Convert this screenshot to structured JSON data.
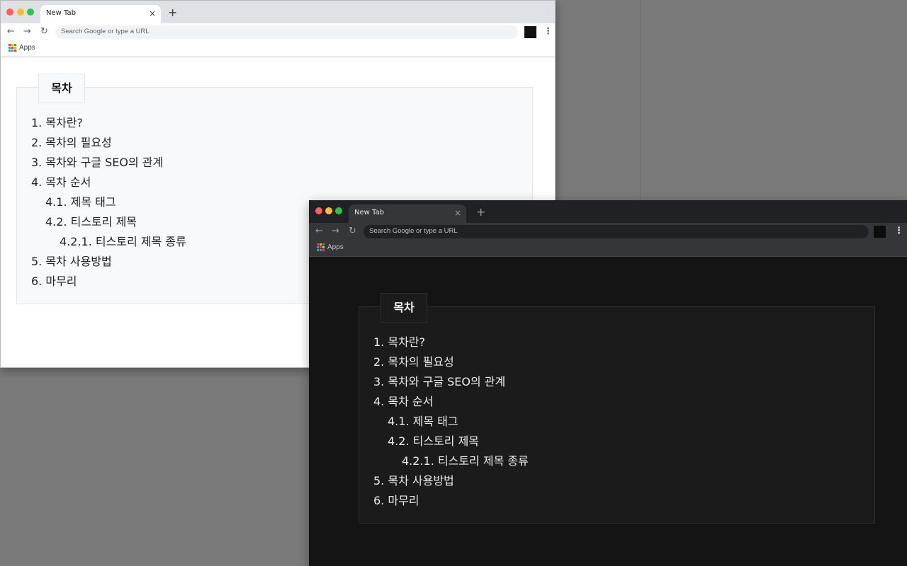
{
  "windows": [
    {
      "theme": "light",
      "tab_title": "New Tab",
      "tab_close": "×",
      "new_tab": "+",
      "omnibox_placeholder": "Search Google or type a URL",
      "bookmark_apps": "Apps",
      "toc": {
        "title": "목차",
        "items": [
          "1. 목차란?",
          "2. 목차의 필요성",
          "3. 목차와 구글 SEO의 관계",
          "4. 목차 순서",
          "4.1. 제목 태그",
          "4.2. 티스토리 제목",
          "4.2.1. 티스토리 제목 종류",
          "5. 목차 사용방법",
          "6. 마무리"
        ]
      }
    },
    {
      "theme": "dark",
      "tab_title": "New Tab",
      "tab_close": "×",
      "new_tab": "+",
      "omnibox_placeholder": "Search Google or type a URL",
      "bookmark_apps": "Apps",
      "toc": {
        "title": "목차",
        "items": [
          "1. 목차란?",
          "2. 목차의 필요성",
          "3. 목차와 구글 SEO의 관계",
          "4. 목차 순서",
          "4.1. 제목 태그",
          "4.2. 티스토리 제목",
          "4.2.1. 티스토리 제목 종류",
          "5. 목차 사용방법",
          "6. 마무리"
        ]
      }
    }
  ],
  "icons": {
    "back": "←",
    "forward": "→",
    "reload": "↻",
    "menu": "⋮"
  },
  "colors": {
    "apps_grid": [
      "#ea4335",
      "#fbbc05",
      "#34a853",
      "#4285f4",
      "#ea4335",
      "#fbbc05",
      "#34a853",
      "#4285f4",
      "#ea4335"
    ]
  }
}
